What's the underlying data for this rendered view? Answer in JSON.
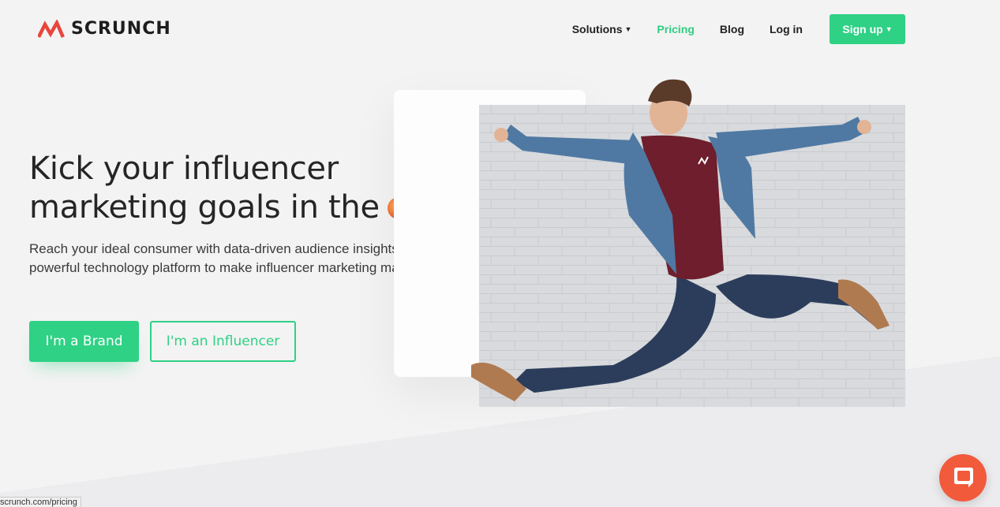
{
  "brand": {
    "name": "SCRUNCH",
    "accent": "#2fd185",
    "logo_color": "#e8453c"
  },
  "nav": {
    "items": [
      {
        "label": "Solutions",
        "has_caret": true
      },
      {
        "label": "Pricing",
        "active": true
      },
      {
        "label": "Blog"
      },
      {
        "label": "Log in"
      }
    ],
    "signup_label": "Sign up"
  },
  "hero": {
    "title": "Kick your influencer marketing goals in the",
    "title_icon": "peach-emoji",
    "subtitle": "Reach your ideal consumer with data-driven audience insights and a powerful technology platform to make influencer marketing magic.",
    "cta_brand": "I'm a Brand",
    "cta_influencer": "I'm an Influencer",
    "image": "jumping-man-photo"
  },
  "status_bar": {
    "url": "scrunch.com/pricing"
  },
  "chat": {
    "icon": "chat-bubble-icon",
    "color": "#f25a3c"
  }
}
